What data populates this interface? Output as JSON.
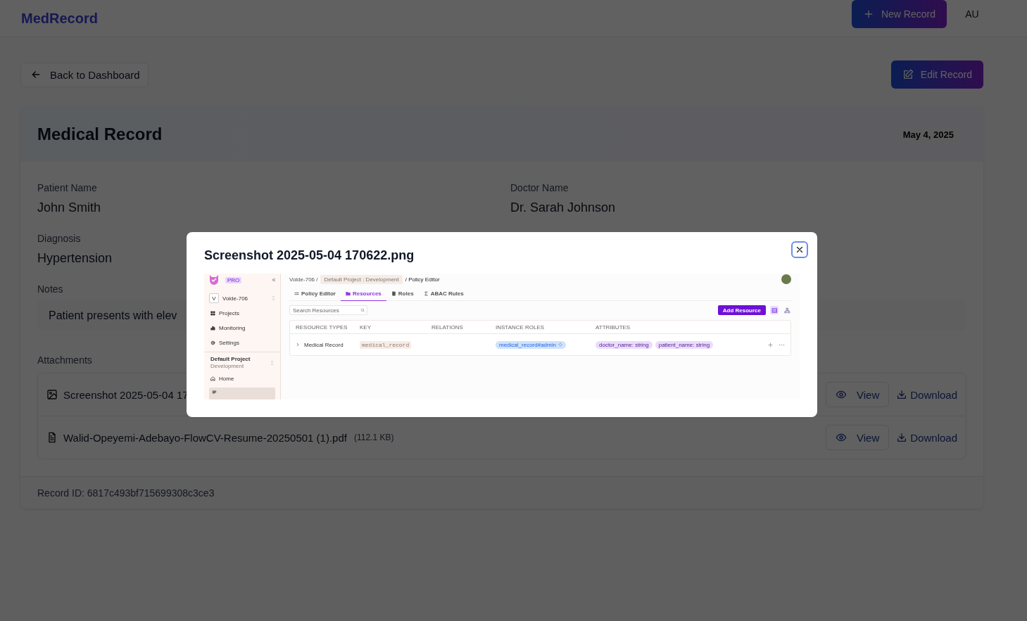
{
  "header": {
    "logo": "MedRecord",
    "new_record_button": "New Record",
    "avatar": "AU"
  },
  "back_button": "Back to Dashboard",
  "edit_button": "Edit Record",
  "record": {
    "title": "Medical Record",
    "date": "May 4, 2025",
    "fields": [
      {
        "label": "Patient Name",
        "value": "John Smith"
      },
      {
        "label": "Doctor Name",
        "value": "Dr. Sarah Johnson"
      },
      {
        "label": "Diagnosis",
        "value": "Hypertension"
      }
    ],
    "notes_label": "Notes",
    "notes": "Patient presents with elev",
    "attachments_label": "Attachments",
    "attachments": [
      {
        "kind": "image",
        "name": "Screenshot 2025-05-04 17",
        "view": "View",
        "download": "Download"
      },
      {
        "kind": "document",
        "name": "Walid-Opeyemi-Adebayo-FlowCV-Resume-20250501 (1).pdf",
        "size": "(112.1 KB)",
        "view": "View",
        "download": "Download"
      }
    ],
    "record_id": "Record ID: 6817c493bf715699308c3ce3"
  },
  "modal": {
    "title": "Screenshot 2025-05-04 170622.png",
    "preview": {
      "sidebar": {
        "badge": "PRO",
        "workspace_initial": "V",
        "workspace": "Volde-706",
        "nav": [
          {
            "kind": "grid",
            "label": "Projects"
          },
          {
            "kind": "chart",
            "label": "Monitoring"
          },
          {
            "kind": "gear",
            "label": "Settings"
          }
        ],
        "project": "Default Project",
        "environment": "Development",
        "project_nav": [
          {
            "kind": "home",
            "label": "Home",
            "selected": false
          },
          {
            "kind": "policy",
            "selected": true
          }
        ]
      },
      "breadcrumb": {
        "workspace": "Volde-706 /",
        "project": "Default Project : Development",
        "page": "/ Policy Editor"
      },
      "tabs": [
        {
          "kind": "list",
          "label": "Policy Editor",
          "selected": false
        },
        {
          "kind": "folder",
          "label": "Resources",
          "selected": true
        },
        {
          "kind": "badge",
          "label": "Roles",
          "selected": false
        },
        {
          "kind": "sigma",
          "label": "ABAC Rules",
          "selected": false
        }
      ],
      "search_placeholder": "Search Resources",
      "add_button": "Add Resource",
      "view_toggle": [
        {
          "kind": "table",
          "selected": true
        },
        {
          "kind": "tree",
          "selected": false
        }
      ],
      "table": {
        "columns": [
          "RESOURCE TYPES",
          "KEY",
          "RELATIONS",
          "INSTANCE ROLES",
          "ATTRIBUTES"
        ],
        "rows": [
          {
            "expanded": false,
            "name": "Medical Record",
            "key": "medical_record",
            "instance_roles": [
              "medical_record#admin"
            ],
            "attributes": [
              "doctor_name: string",
              "patient_name: string"
            ]
          }
        ]
      }
    }
  }
}
